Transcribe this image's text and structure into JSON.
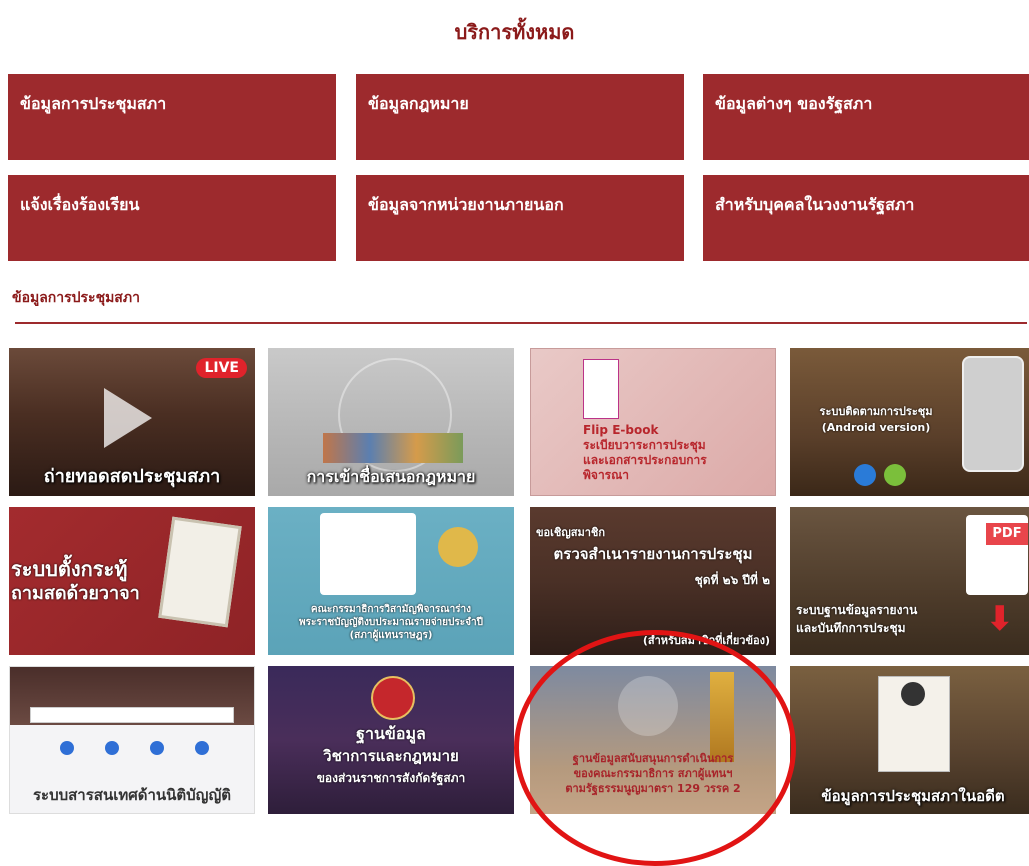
{
  "header": {
    "title": "บริการทั้งหมด"
  },
  "categories": [
    "ข้อมูลการประชุมสภา",
    "ข้อมูลกฎหมาย",
    "ข้อมูลต่างๆ ของรัฐสภา",
    "แจ้งเรื่องร้องเรียน",
    "ข้อมูลจากหน่วยงานภายนอก",
    "สำหรับบุคคลในวงงานรัฐสภา"
  ],
  "section": {
    "label": "ข้อมูลการประชุมสภา"
  },
  "tiles": {
    "t1": {
      "caption": "ถ่ายทอดสดประชุมสภา",
      "badge": "LIVE"
    },
    "t2": {
      "caption": "การเข้าชื่อเสนอกฎหมาย"
    },
    "t3": {
      "line1": "Flip E-book",
      "line2": "ระเบียบวาระการประชุม",
      "line3": "และเอกสารประกอบการ",
      "line4": "พิจารณา"
    },
    "t4": {
      "line1": "ระบบติดตามการประชุม",
      "line2": "(Android version)"
    },
    "t5": {
      "line1": "ระบบตั้งกระทู้",
      "line2": "ถามสดด้วยวาจา"
    },
    "t6": {
      "line1": "คณะกรรมาธิการวิสามัญพิจารณาร่าง",
      "line2": "พระราชบัญญัติงบประมาณรายจ่ายประจำปี",
      "line3": "(สภาผู้แทนราษฎร)"
    },
    "t7": {
      "line1": "ขอเชิญสมาชิก",
      "line2": "ตรวจสำเนารายงานการประชุม",
      "line3": "ชุดที่ ๒๖ ปีที่ ๒",
      "line4": "(สำหรับสมาชิกที่เกี่ยวข้อง)"
    },
    "t8": {
      "badge": "PDF",
      "line1": "ระบบฐานข้อมูลรายงาน",
      "line2": "และบันทึกการประชุม"
    },
    "t9": {
      "caption": "ระบบสารสนเทศด้านนิติบัญญัติ"
    },
    "t10": {
      "line1": "ฐานข้อมูล",
      "line2": "วิชาการและกฎหมาย",
      "line3": "ของส่วนราชการสังกัดรัฐสภา"
    },
    "t11": {
      "line1": "ฐานข้อมูลสนับสนุนการดำเนินการ",
      "line2": "ของคณะกรรมาธิการ สภาผู้แทนฯ",
      "line3": "ตามรัฐธรรมนูญมาตรา 129 วรรค 2"
    },
    "t12": {
      "caption": "ข้อมูลการประชุมสภาในอดีต"
    }
  },
  "colors": {
    "brand": "#9d2a2d",
    "highlight_circle": "#e11414"
  }
}
